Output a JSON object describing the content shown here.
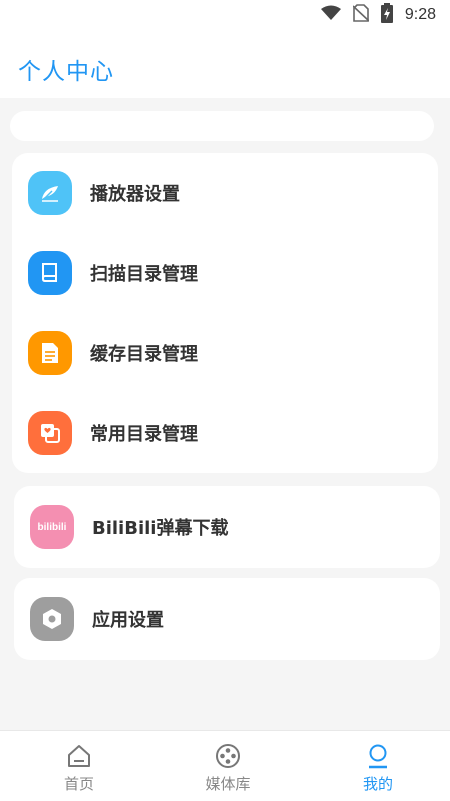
{
  "status_bar": {
    "time": "9:28",
    "icons": [
      "wifi-icon",
      "no-sim-icon",
      "battery-charging-icon"
    ]
  },
  "header": {
    "title": "个人中心"
  },
  "menu": {
    "group1": [
      {
        "label": "播放器设置",
        "icon": "feather-icon",
        "color": "#4fc3f7"
      },
      {
        "label": "扫描目录管理",
        "icon": "book-icon",
        "color": "#2196f3"
      },
      {
        "label": "缓存目录管理",
        "icon": "document-icon",
        "color": "#ff9800"
      },
      {
        "label": "常用目录管理",
        "icon": "folder-heart-icon",
        "color": "#ff6f3c"
      }
    ],
    "group2": [
      {
        "label": "BiliBili弹幕下载",
        "icon": "bilibili-logo-icon",
        "color": "#f48fb1",
        "icon_text": "bilibili"
      }
    ],
    "group3": [
      {
        "label": "应用设置",
        "icon": "hexagon-settings-icon",
        "color": "#9e9e9e"
      }
    ]
  },
  "bottom_nav": {
    "items": [
      {
        "label": "首页",
        "icon": "home-icon",
        "active": false
      },
      {
        "label": "媒体库",
        "icon": "film-reel-icon",
        "active": false
      },
      {
        "label": "我的",
        "icon": "user-icon",
        "active": true
      }
    ],
    "active_color": "#2196f3",
    "inactive_color": "#888888"
  }
}
